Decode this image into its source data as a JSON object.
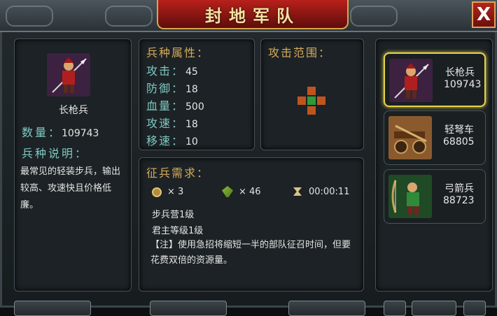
{
  "title": "封地军队",
  "close_label": "X",
  "selected_unit": {
    "name": "长枪兵",
    "count_label": "数量：",
    "count": "109743",
    "desc_title": "兵种说明：",
    "desc": "最常见的轻装步兵，输出较高、攻速快且价格低廉。"
  },
  "attributes": {
    "title": "兵种属性：",
    "rows": [
      {
        "label": "攻击：",
        "value": "45"
      },
      {
        "label": "防御：",
        "value": "18"
      },
      {
        "label": "血量：",
        "value": "500"
      },
      {
        "label": "攻速：",
        "value": "18"
      },
      {
        "label": "移速：",
        "value": "10"
      }
    ]
  },
  "range": {
    "title": "攻击范围："
  },
  "requirements": {
    "title": "征兵需求：",
    "coin": "× 3",
    "grain": "× 46",
    "time": "00:00:11",
    "line1": "步兵营1级",
    "line2": "君主等级1级",
    "note": "【注】使用急招将缩短一半的部队征召时间，但要花费双倍的资源量。"
  },
  "units": [
    {
      "name": "长枪兵",
      "count": "109743"
    },
    {
      "name": "轻弩车",
      "count": "68805"
    },
    {
      "name": "弓箭兵",
      "count": "88723"
    }
  ],
  "colors": {
    "accent": "#d6ab5a",
    "text_cyan": "#7fc9c2",
    "selected": "#e6d24a"
  }
}
